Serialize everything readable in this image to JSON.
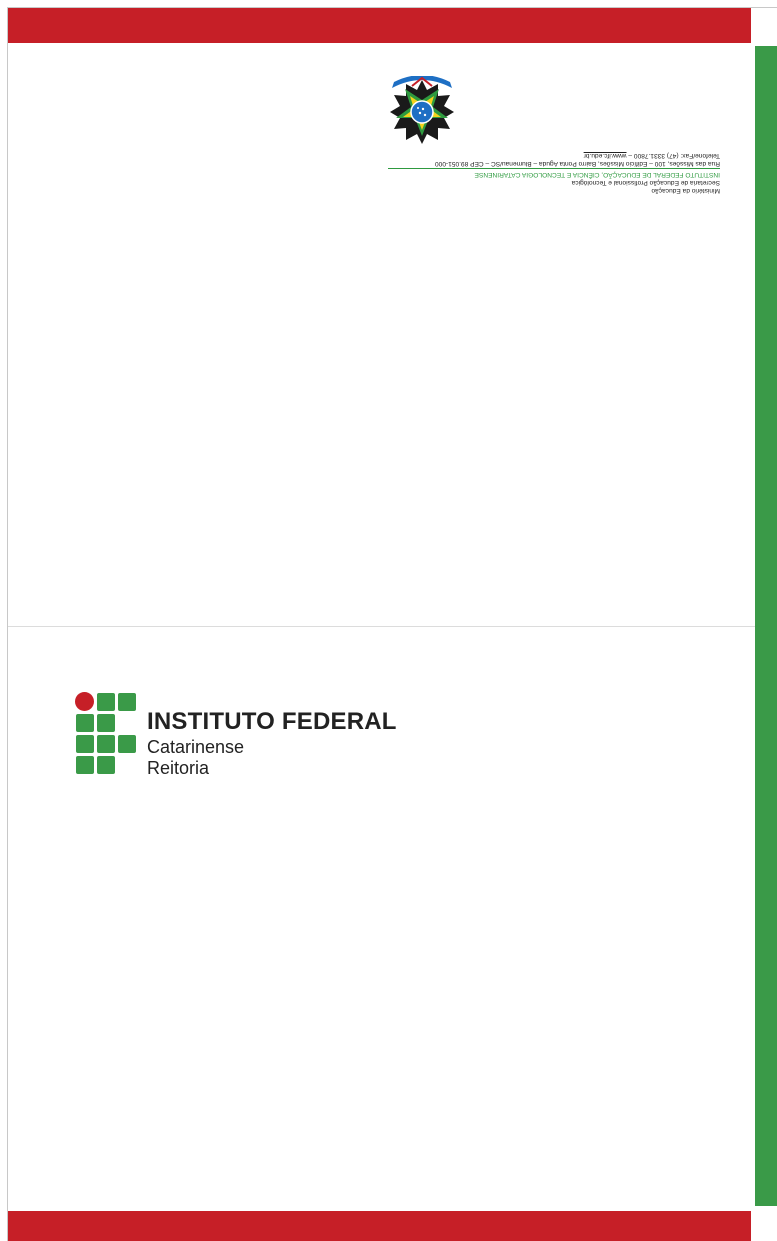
{
  "letterhead": {
    "ministry": "Ministério da Educação",
    "secretariat": "Secretaria de Educação Profissional e Tecnológica",
    "institute_full": "INSTITUTO FEDERAL DE EDUCAÇÃO, CIÊNCIA E TECNOLOGIA CATARINENSE",
    "address": "Rua das Missões, 100 – Edifício Missões, Bairro Ponta Aguda – Blumenau/SC – CEP 89.051-000",
    "phone_prefix": "Telefone/Fax: (47) 3331.7800 – ",
    "website": "www.ifc.edu.br",
    "seal_icon": "republic-coat-of-arms-icon"
  },
  "logo": {
    "title": "INSTITUTO FEDERAL",
    "subtitle": "Catarinense",
    "unit": "Reitoria"
  },
  "colors": {
    "brand_red": "#c61f27",
    "brand_green": "#3a9a48"
  }
}
